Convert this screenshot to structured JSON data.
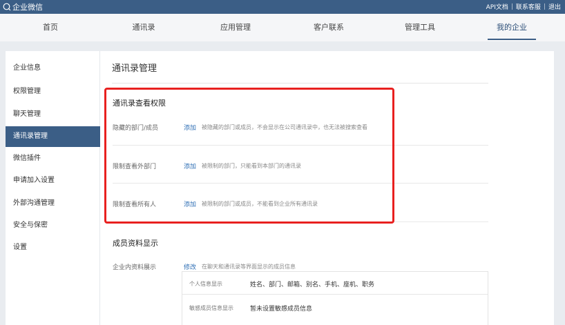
{
  "brand": {
    "name": "企业微信"
  },
  "toplinks": [
    "API文档",
    "联系客服",
    "退出"
  ],
  "nav": {
    "tabs": [
      "首页",
      "通讯录",
      "应用管理",
      "客户联系",
      "管理工具",
      "我的企业"
    ],
    "active": "我的企业"
  },
  "sidebar": {
    "items": [
      "企业信息",
      "权限管理",
      "聊天管理",
      "通讯录管理",
      "微信插件",
      "申请加入设置",
      "外部沟通管理",
      "安全与保密",
      "设置"
    ],
    "active": "通讯录管理"
  },
  "main": {
    "title": "通讯录管理",
    "view_perm": {
      "title": "通讯录查看权限",
      "rows": [
        {
          "label": "隐藏的部门/成员",
          "action": "添加",
          "desc": "被隐藏的部门或成员，不会显示在公司通讯录中，也无法被搜索查看"
        },
        {
          "label": "限制查看外部门",
          "action": "添加",
          "desc": "被限制的部门，只能看到本部门的通讯录"
        },
        {
          "label": "限制查看所有人",
          "action": "添加",
          "desc": "被限制的部门或成员，不能看到企业所有通讯录"
        }
      ]
    },
    "member_display": {
      "title": "成员资料显示",
      "label": "企业内资料展示",
      "action": "修改",
      "desc": "在聊天和通讯录等界面显示的成员信息",
      "rows": [
        {
          "label": "个人信息显示",
          "value": "姓名、部门、邮箱、别名、手机、座机、职务"
        },
        {
          "label": "敏感成员信息显示",
          "value": "暂未设置敏感成员信息"
        }
      ]
    }
  },
  "colors": {
    "topbar": "#3b5e86",
    "highlight": "#e8201f",
    "link": "#2f6fb5"
  }
}
